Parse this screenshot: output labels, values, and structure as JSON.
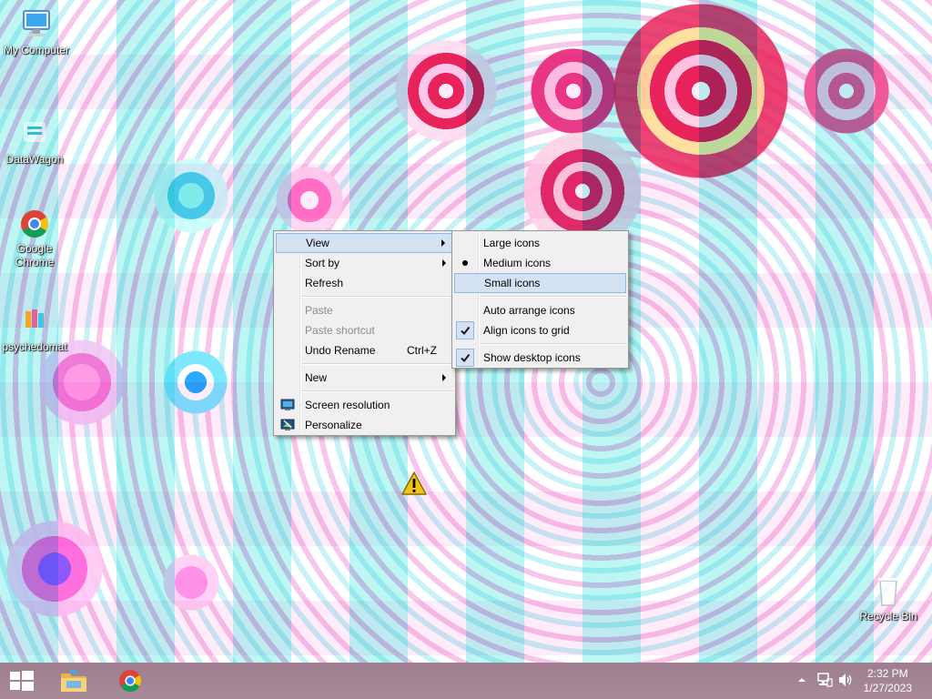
{
  "desktop": {
    "icons": [
      {
        "label": "My Computer"
      },
      {
        "label": "DataWagon"
      },
      {
        "label": "Google Chrome"
      },
      {
        "label": "psychedomat"
      },
      {
        "label": "Recycle Bin"
      }
    ]
  },
  "context_menu": {
    "items": [
      {
        "label": "View",
        "submenu": true,
        "highlighted": true
      },
      {
        "label": "Sort by",
        "submenu": true
      },
      {
        "label": "Refresh"
      },
      {
        "label": "Paste",
        "disabled": true
      },
      {
        "label": "Paste shortcut",
        "disabled": true
      },
      {
        "label": "Undo Rename",
        "shortcut": "Ctrl+Z"
      },
      {
        "label": "New",
        "submenu": true
      },
      {
        "label": "Screen resolution",
        "icon": "screen-resolution-icon"
      },
      {
        "label": "Personalize",
        "icon": "personalize-icon"
      }
    ]
  },
  "view_submenu": {
    "items": [
      {
        "label": "Large icons"
      },
      {
        "label": "Medium icons",
        "selected": true
      },
      {
        "label": "Small icons",
        "highlighted": true
      },
      {
        "label": "Auto arrange icons"
      },
      {
        "label": "Align icons to grid",
        "checked": true
      },
      {
        "label": "Show desktop icons",
        "checked": true
      }
    ]
  },
  "taskbar": {
    "start": "windows-start-icon",
    "pinned": [
      "file-explorer-icon",
      "chrome-icon"
    ],
    "tray_icons": [
      "show-hidden-icons-arrow",
      "network-icon",
      "volume-icon"
    ],
    "time": "2:32 PM",
    "date": "1/27/2023"
  },
  "colors": {
    "menu_bg": "#f0f0f0",
    "highlight_bg": "#d5e2f3",
    "highlight_border": "#93b7e3",
    "taskbar": "#a4879a"
  }
}
